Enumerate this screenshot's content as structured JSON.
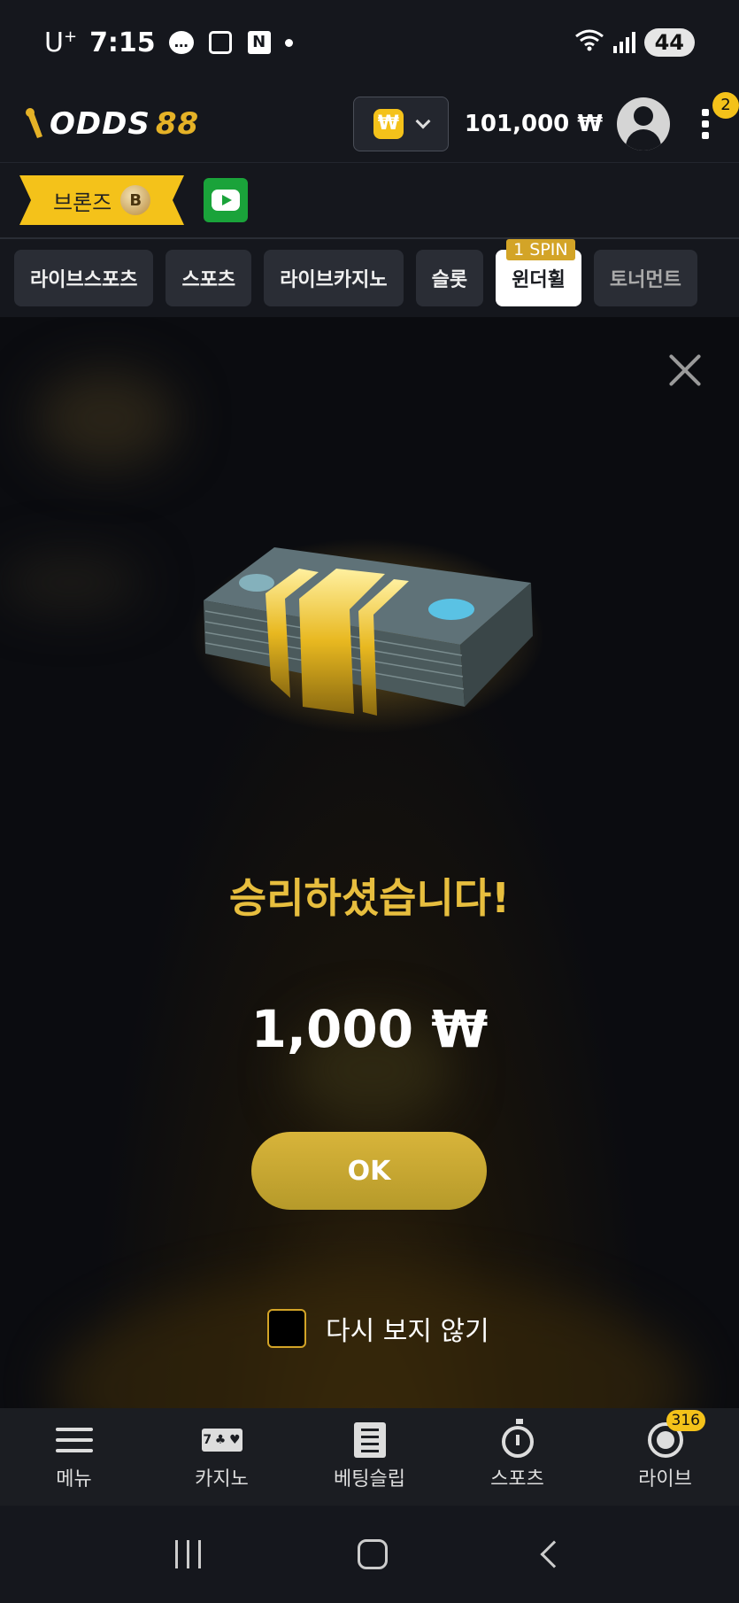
{
  "status_bar": {
    "carrier": "U",
    "carrier_sup": "+",
    "time": "7:15",
    "battery": "44"
  },
  "header": {
    "logo_text_white": "ODDS",
    "logo_text_gold": "88",
    "currency_symbol": "₩",
    "balance": "101,000 ₩",
    "menu_badge": "2"
  },
  "subheader": {
    "rank_label": "브론즈",
    "rank_coin": "B"
  },
  "tabs": [
    {
      "label": "라이브스포츠"
    },
    {
      "label": "스포츠"
    },
    {
      "label": "라이브카지노"
    },
    {
      "label": "슬롯"
    },
    {
      "label": "윈더휠",
      "badge": "1 SPIN",
      "active": true
    },
    {
      "label": "토너먼트"
    }
  ],
  "modal": {
    "title": "승리하셨습니다!",
    "amount": "1,000 ₩",
    "ok_label": "OK",
    "dont_show_label": "다시 보지 않기"
  },
  "bottom_nav": [
    {
      "label": "메뉴",
      "icon": "menu-icon"
    },
    {
      "label": "카지노",
      "icon": "slot-icon"
    },
    {
      "label": "베팅슬립",
      "icon": "betslip-icon"
    },
    {
      "label": "스포츠",
      "icon": "stopwatch-icon"
    },
    {
      "label": "라이브",
      "icon": "live-icon",
      "badge": "316"
    }
  ],
  "colors": {
    "gold": "#e7be3e",
    "accent_yellow": "#f4c21a",
    "bg": "#0b0c10",
    "panel": "#15171d"
  }
}
